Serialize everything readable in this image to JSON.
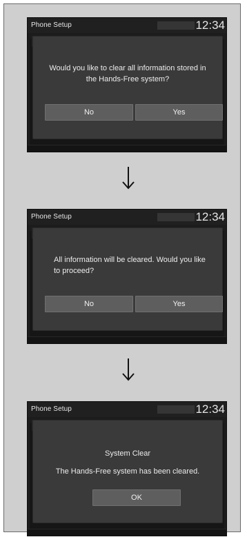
{
  "screens": [
    {
      "title": "Phone Setup",
      "clock": "12:34",
      "message": "Would you like to clear all information stored in the Hands-Free system?",
      "buttons": {
        "no": "No",
        "yes": "Yes"
      }
    },
    {
      "title": "Phone Setup",
      "clock": "12:34",
      "message": "All information will be cleared. Would you like to proceed?",
      "buttons": {
        "no": "No",
        "yes": "Yes"
      }
    },
    {
      "title": "Phone Setup",
      "clock": "12:34",
      "dialog_title": "System Clear",
      "message": "The Hands-Free system has been cleared.",
      "buttons": {
        "ok": "OK"
      }
    }
  ],
  "arrows": [
    "down-arrow-icon",
    "down-arrow-icon"
  ],
  "colors": {
    "frame": "#cfcfcf",
    "screen": "#1c1c1c",
    "dialog": "#3a3a3a",
    "button": "#5e5e5e",
    "text": "#ececec"
  }
}
